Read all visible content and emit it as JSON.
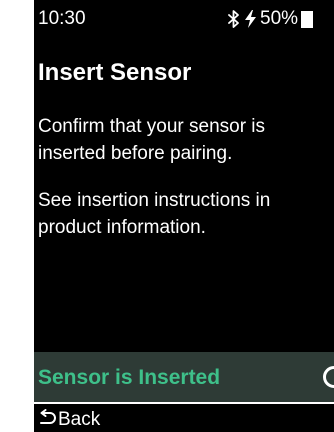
{
  "status_bar": {
    "time": "10:30",
    "battery_percent": "50%",
    "icons": [
      "bluetooth-icon",
      "charging-bolt-icon",
      "battery-icon"
    ]
  },
  "screen": {
    "title": "Insert Sensor",
    "paragraph_1": "Confirm that your sensor is inserted before pairing.",
    "paragraph_2": "See insertion instructions in product information."
  },
  "confirm_button": {
    "label": "Sensor is Inserted"
  },
  "back_button": {
    "label": "Back",
    "icon": "back-arrow-icon"
  },
  "colors": {
    "background": "#000000",
    "text": "#ffffff",
    "accent": "#3ec08a",
    "confirm_bar": "#2e3b36"
  }
}
